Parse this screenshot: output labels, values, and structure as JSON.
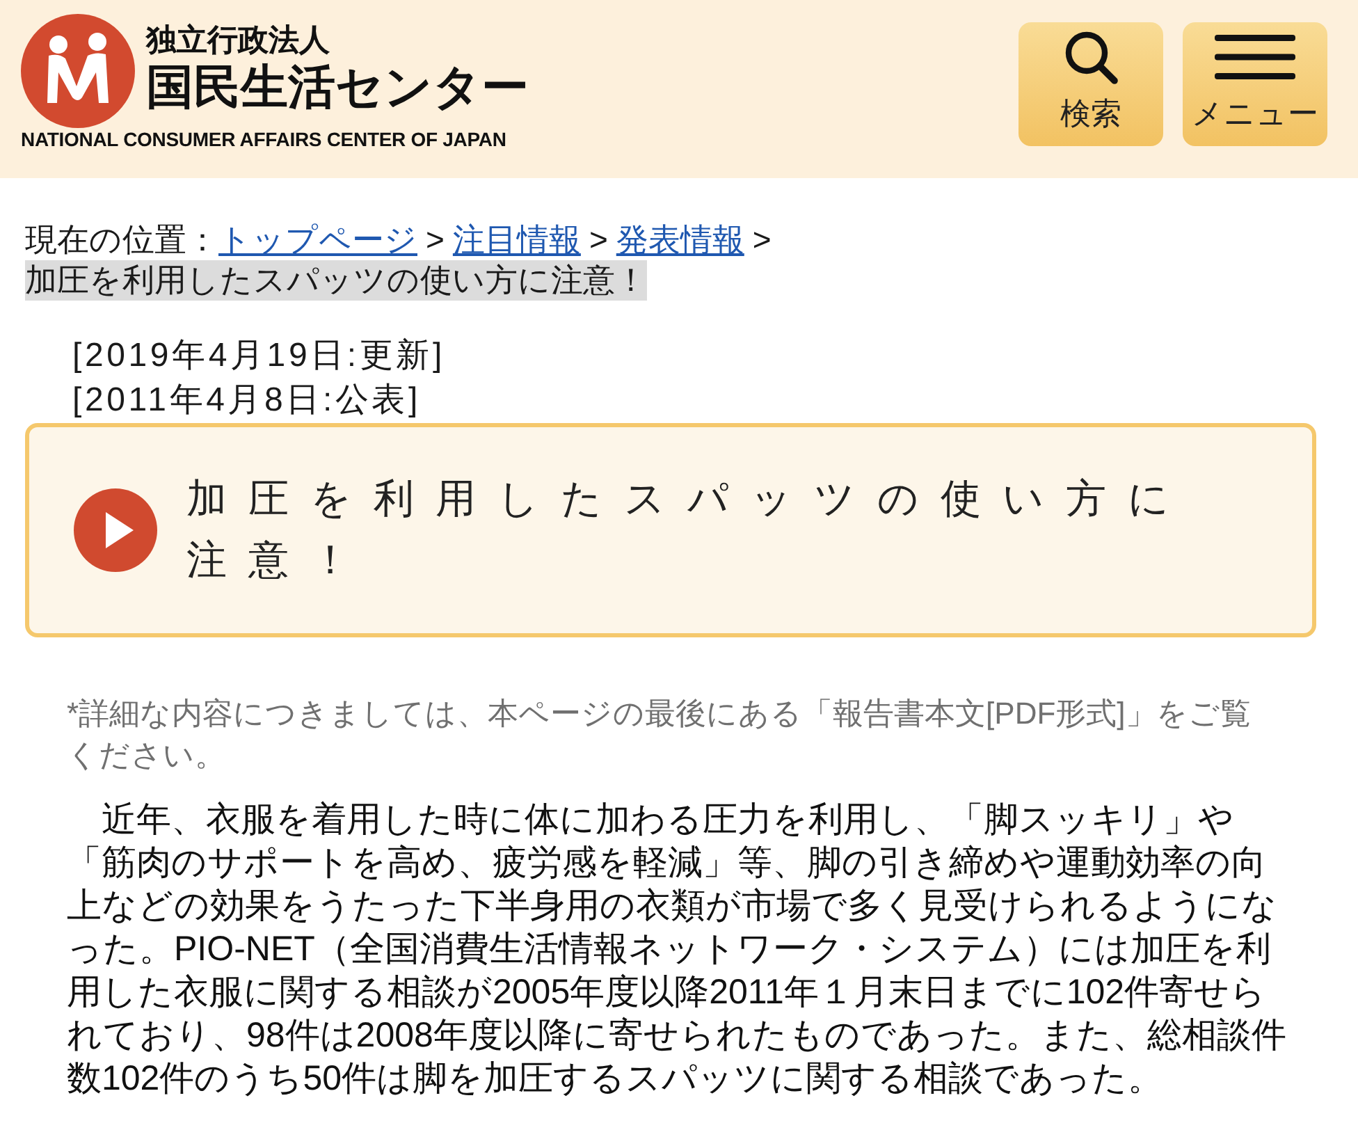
{
  "header": {
    "org_type": "独立行政法人",
    "org_name": "国民生活センター",
    "org_name_en": "NATIONAL CONSUMER AFFAIRS CENTER OF JAPAN",
    "buttons": [
      {
        "kind": "search",
        "label": "検索"
      },
      {
        "kind": "menu",
        "label": "メニュー"
      }
    ]
  },
  "breadcrumb": {
    "label": "現在の位置：",
    "items": [
      {
        "kind": "link",
        "text": "トップページ"
      },
      {
        "kind": "link",
        "separator": ">",
        "text": "注目情報"
      },
      {
        "kind": "link",
        "separator": ">",
        "text": "発表情報"
      },
      {
        "kind": "current",
        "separator": ">",
        "text": "加圧を利用したスパッツの使い方に注意！"
      }
    ]
  },
  "dates": [
    "[2019年4月19日:更新]",
    "[2011年4月8日:公表]"
  ],
  "title": "加圧を利用したスパッツの使い方に注意！",
  "note": "*詳細な内容につきましては、本ページの最後にある「報告書本文[PDF形式]」をご覧ください。",
  "paragraphs": [
    "近年、衣服を着用した時に体に加わる圧力を利用し、「脚スッキリ」や「筋肉のサポートを高め、疲労感を軽減」等、脚の引き締めや運動効率の向上などの効果をうたった下半身用の衣類が市場で多く見受けられるようになった。PIO-NET（全国消費生活情報ネットワーク・システム）には加圧を利用した衣服に関する相談が2005年度以降2011年１月末日までに102件寄せられており、98件は2008年度以降に寄せられたものであった。また、総相談件数102件のうち50件は脚を加圧するスパッツに関する相談であった。"
  ]
}
